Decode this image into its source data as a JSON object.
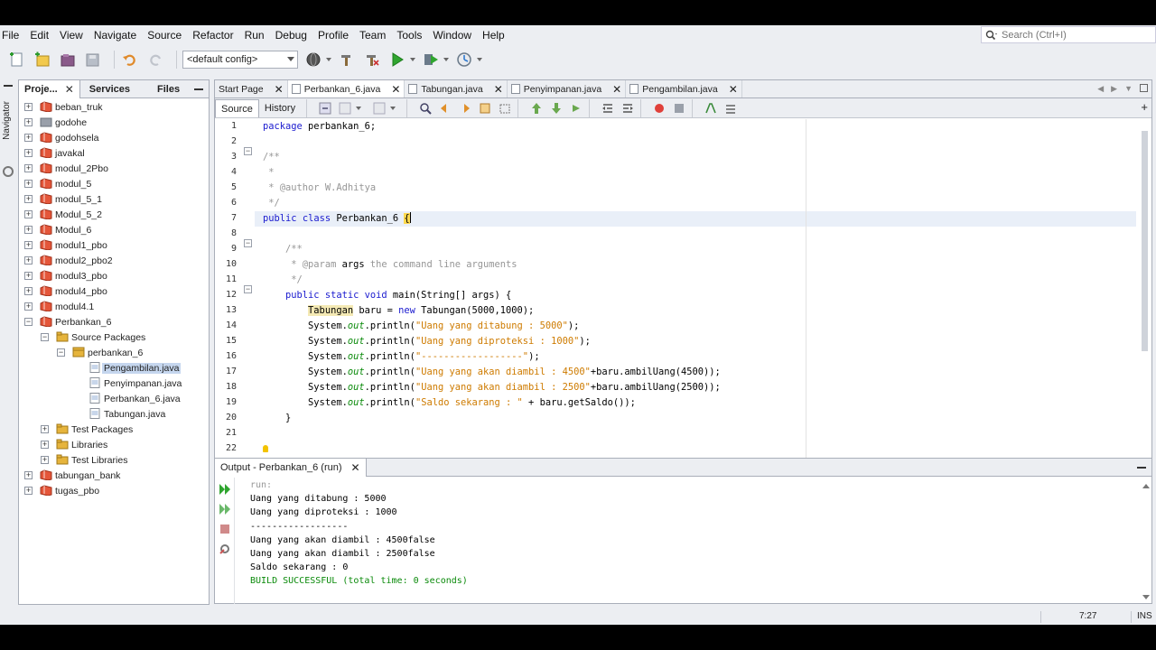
{
  "menu": [
    "File",
    "Edit",
    "View",
    "Navigate",
    "Source",
    "Refactor",
    "Run",
    "Debug",
    "Profile",
    "Team",
    "Tools",
    "Window",
    "Help"
  ],
  "search": {
    "placeholder": "Search (Ctrl+I)"
  },
  "toolbar": {
    "config": "<default config>"
  },
  "navigator": {
    "label": "Navigator"
  },
  "left_tabs": {
    "projects": "Proje...",
    "services": "Services",
    "files": "Files",
    "close": "✕"
  },
  "tree": [
    {
      "label": "beban_truk",
      "level": 0,
      "toggle": "+",
      "icon": "project-icon"
    },
    {
      "label": "godohe",
      "level": 0,
      "toggle": "+",
      "icon": "project-icon-gray"
    },
    {
      "label": "godohsela",
      "level": 0,
      "toggle": "+",
      "icon": "project-icon"
    },
    {
      "label": "javakal",
      "level": 0,
      "toggle": "+",
      "icon": "project-icon"
    },
    {
      "label": "modul_2Pbo",
      "level": 0,
      "toggle": "+",
      "icon": "project-icon"
    },
    {
      "label": "modul_5",
      "level": 0,
      "toggle": "+",
      "icon": "project-icon"
    },
    {
      "label": "modul_5_1",
      "level": 0,
      "toggle": "+",
      "icon": "project-icon"
    },
    {
      "label": "Modul_5_2",
      "level": 0,
      "toggle": "+",
      "icon": "project-icon"
    },
    {
      "label": "Modul_6",
      "level": 0,
      "toggle": "+",
      "icon": "project-icon"
    },
    {
      "label": "modul1_pbo",
      "level": 0,
      "toggle": "+",
      "icon": "project-icon"
    },
    {
      "label": "modul2_pbo2",
      "level": 0,
      "toggle": "+",
      "icon": "project-icon"
    },
    {
      "label": "modul3_pbo",
      "level": 0,
      "toggle": "+",
      "icon": "project-icon"
    },
    {
      "label": "modul4_pbo",
      "level": 0,
      "toggle": "+",
      "icon": "project-icon"
    },
    {
      "label": "modul4.1",
      "level": 0,
      "toggle": "+",
      "icon": "project-icon"
    },
    {
      "label": "Perbankan_6",
      "level": 0,
      "toggle": "−",
      "icon": "project-icon"
    },
    {
      "label": "Source Packages",
      "level": 1,
      "toggle": "−",
      "icon": "folder-icon"
    },
    {
      "label": "perbankan_6",
      "level": 2,
      "toggle": "−",
      "icon": "package-icon"
    },
    {
      "label": "Pengambilan.java",
      "level": 3,
      "toggle": "",
      "icon": "java-file-icon",
      "selected": true
    },
    {
      "label": "Penyimpanan.java",
      "level": 3,
      "toggle": "",
      "icon": "java-file-icon"
    },
    {
      "label": "Perbankan_6.java",
      "level": 3,
      "toggle": "",
      "icon": "java-file-icon"
    },
    {
      "label": "Tabungan.java",
      "level": 3,
      "toggle": "",
      "icon": "java-file-icon"
    },
    {
      "label": "Test Packages",
      "level": 1,
      "toggle": "+",
      "icon": "folder-icon"
    },
    {
      "label": "Libraries",
      "level": 1,
      "toggle": "+",
      "icon": "folder-icon"
    },
    {
      "label": "Test Libraries",
      "level": 1,
      "toggle": "+",
      "icon": "folder-icon"
    },
    {
      "label": "tabungan_bank",
      "level": 0,
      "toggle": "+",
      "icon": "project-icon"
    },
    {
      "label": "tugas_pbo",
      "level": 0,
      "toggle": "+",
      "icon": "project-icon"
    }
  ],
  "editor_tabs": [
    {
      "label": "Start Page",
      "active": false
    },
    {
      "label": "Perbankan_6.java",
      "active": true
    },
    {
      "label": "Tabungan.java",
      "active": false
    },
    {
      "label": "Penyimpanan.java",
      "active": false
    },
    {
      "label": "Pengambilan.java",
      "active": false
    }
  ],
  "editor_toolbar": {
    "source": "Source",
    "history": "History"
  },
  "line_numbers": [
    "1",
    "2",
    "3",
    "4",
    "5",
    "6",
    "7",
    "8",
    "9",
    "10",
    "11",
    "12",
    "13",
    "14",
    "15",
    "16",
    "17",
    "18",
    "19",
    "20",
    "21",
    "22"
  ],
  "code_lines": [
    [
      [
        "kw",
        "package"
      ],
      [
        "p",
        " perbankan_6;"
      ]
    ],
    [],
    [
      [
        "cmt",
        "/**"
      ]
    ],
    [
      [
        "cmt",
        " *"
      ]
    ],
    [
      [
        "cmt",
        " * @author W.Adhitya"
      ]
    ],
    [
      [
        "cmt",
        " */"
      ]
    ],
    [
      [
        "kw",
        "public"
      ],
      [
        "p",
        " "
      ],
      [
        "kw",
        "class"
      ],
      [
        "p",
        " Perbankan_6 "
      ],
      [
        "brace",
        "{"
      ]
    ],
    [],
    [
      [
        "cmt",
        "    /**"
      ]
    ],
    [
      [
        "cmt",
        "     * @param "
      ],
      [
        "p",
        "args"
      ],
      [
        "cmt",
        " the command line arguments"
      ]
    ],
    [
      [
        "cmt",
        "     */"
      ]
    ],
    [
      [
        "p",
        "    "
      ],
      [
        "kw",
        "public static void"
      ],
      [
        "p",
        " main(String[] args) {"
      ]
    ],
    [
      [
        "p",
        "        "
      ],
      [
        "hl",
        "Tabungan"
      ],
      [
        "p",
        " baru = "
      ],
      [
        "kw",
        "new"
      ],
      [
        "p",
        " Tabungan(5000,1000);"
      ]
    ],
    [
      [
        "p",
        "        System."
      ],
      [
        "fld",
        "out"
      ],
      [
        "p",
        ".println("
      ],
      [
        "str",
        "\"Uang yang ditabung : 5000\""
      ],
      [
        "p",
        ");"
      ]
    ],
    [
      [
        "p",
        "        System."
      ],
      [
        "fld",
        "out"
      ],
      [
        "p",
        ".println("
      ],
      [
        "str",
        "\"Uang yang diproteksi : 1000\""
      ],
      [
        "p",
        ");"
      ]
    ],
    [
      [
        "p",
        "        System."
      ],
      [
        "fld",
        "out"
      ],
      [
        "p",
        ".println("
      ],
      [
        "str",
        "\"------------------\""
      ],
      [
        "p",
        ");"
      ]
    ],
    [
      [
        "p",
        "        System."
      ],
      [
        "fld",
        "out"
      ],
      [
        "p",
        ".println("
      ],
      [
        "str",
        "\"Uang yang akan diambil : 4500\""
      ],
      [
        "p",
        "+baru.ambilUang(4500));"
      ]
    ],
    [
      [
        "p",
        "        System."
      ],
      [
        "fld",
        "out"
      ],
      [
        "p",
        ".println("
      ],
      [
        "str",
        "\"Uang yang akan diambil : 2500\""
      ],
      [
        "p",
        "+baru.ambilUang(2500));"
      ]
    ],
    [
      [
        "p",
        "        System."
      ],
      [
        "fld",
        "out"
      ],
      [
        "p",
        ".println("
      ],
      [
        "str",
        "\"Saldo sekarang : \""
      ],
      [
        "p",
        " + baru.getSaldo());"
      ]
    ],
    [
      [
        "p",
        "    }"
      ]
    ],
    [],
    [
      [
        "p",
        ""
      ]
    ]
  ],
  "output": {
    "title": "Output - Perbankan_6 (run)",
    "lines": [
      {
        "text": "run:",
        "style": "muted"
      },
      {
        "text": "Uang yang ditabung : 5000",
        "style": ""
      },
      {
        "text": "Uang yang diproteksi : 1000",
        "style": ""
      },
      {
        "text": "------------------",
        "style": ""
      },
      {
        "text": "Uang yang akan diambil : 4500false",
        "style": ""
      },
      {
        "text": "Uang yang akan diambil : 2500false",
        "style": ""
      },
      {
        "text": "Saldo sekarang : 0",
        "style": ""
      },
      {
        "text": "BUILD SUCCESSFUL (total time: 0 seconds)",
        "style": "ok"
      }
    ]
  },
  "status": {
    "position": "7:27",
    "mode": "INS"
  }
}
